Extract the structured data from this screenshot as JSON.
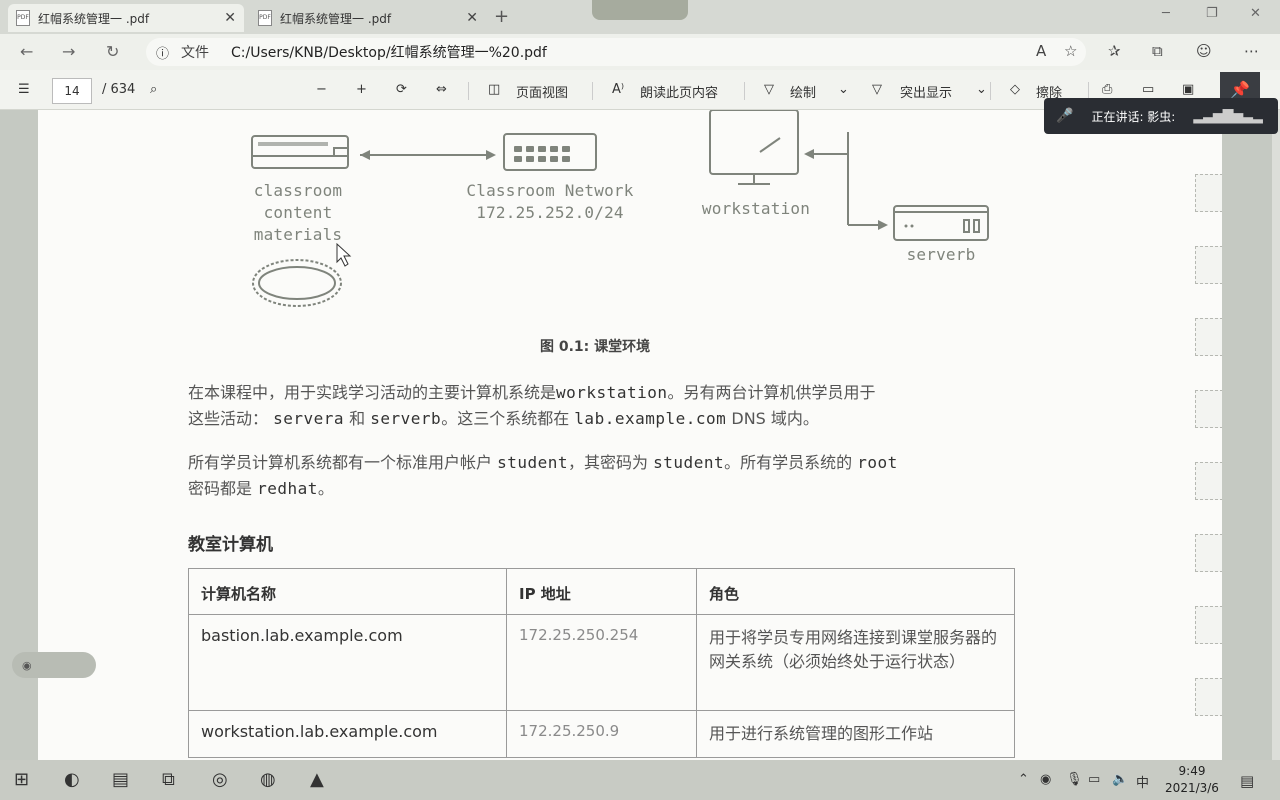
{
  "browser": {
    "tabs": [
      {
        "title": "红帽系统管理一 .pdf",
        "active": true
      },
      {
        "title": "红帽系统管理一 .pdf",
        "active": false
      }
    ],
    "new_tab": "+",
    "address_label": "文件",
    "url": "C:/Users/KNB/Desktop/红帽系统管理一%20.pdf"
  },
  "pdf_toolbar": {
    "page_current": "14",
    "page_total": "/ 634",
    "page_view": "页面视图",
    "read_aloud": "朗读此页内容",
    "draw": "绘制",
    "highlight": "突出显示",
    "erase": "擦除"
  },
  "speech_popup": {
    "text": "正在讲话: 影虫:"
  },
  "diagram": {
    "materials_label": [
      "classroom",
      "content",
      "materials"
    ],
    "network_label": [
      "Classroom Network",
      "172.25.252.0/24"
    ],
    "workstation_label": "workstation",
    "serverb_label": "serverb"
  },
  "document": {
    "caption": "图 0.1: 课堂环境",
    "para1": {
      "t1": "在本课程中，用于实践学习活动的主要计算机系统是",
      "c1": "workstation",
      "t2": "。另有两台计算机供学员用于",
      "t3": "这些活动：",
      "c2": "servera",
      "t4": "和",
      "c3": "serverb",
      "t5": "。这三个系统都在",
      "c4": "lab.example.com",
      "t6": "DNS 域内。"
    },
    "para2": {
      "t1": "所有学员计算机系统都有一个标准用户帐户",
      "c1": "student",
      "t2": "，其密码为",
      "c2": "student",
      "t3": "。所有学员系统的",
      "c3": "root",
      "t4": "密码都是",
      "c4": "redhat",
      "t5": "。"
    },
    "section_heading": "教室计算机",
    "table": {
      "headers": [
        "计算机名称",
        "IP 地址",
        "角色"
      ],
      "rows": [
        {
          "host": "bastion.lab.example.com",
          "ip": "172.25.250.254",
          "role": "用于将学员专用网络连接到课堂服务器的网关系统（必须始终处于运行状态）"
        },
        {
          "host": "workstation.lab.example.com",
          "ip": "172.25.250.9",
          "role": "用于进行系统管理的图形工作站"
        }
      ]
    }
  },
  "taskbar": {
    "ime": "中",
    "time": "9:49",
    "date": "2021/3/6"
  },
  "colors": {
    "page_bg": "#fbfbf9",
    "diagram_gray": "#7f847c",
    "taskbar": "#c8cbc4"
  }
}
